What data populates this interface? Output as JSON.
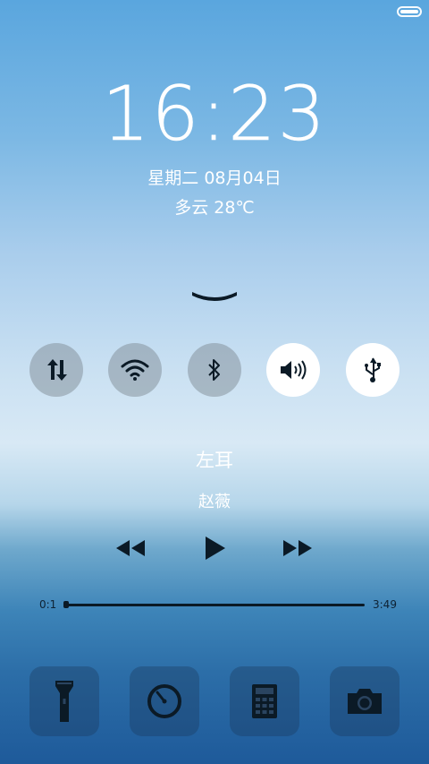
{
  "status_bar": {
    "battery_level": 1.0
  },
  "lockscreen": {
    "time": "16:23",
    "date": "星期二 08月04日",
    "weather": "多云 28℃"
  },
  "quick_toggles": [
    {
      "name": "sync",
      "icon": "sync-icon",
      "state": "off"
    },
    {
      "name": "wifi",
      "icon": "wifi-icon",
      "state": "off"
    },
    {
      "name": "bluetooth",
      "icon": "bluetooth-icon",
      "state": "off"
    },
    {
      "name": "sound",
      "icon": "volume-icon",
      "state": "on"
    },
    {
      "name": "usb",
      "icon": "usb-icon",
      "state": "on"
    }
  ],
  "music": {
    "title": "左耳",
    "artist": "赵薇",
    "elapsed": "0:1",
    "duration": "3:49",
    "progress": 0.004
  },
  "shortcuts": [
    {
      "name": "flashlight",
      "icon": "flashlight-icon"
    },
    {
      "name": "timer",
      "icon": "timer-icon"
    },
    {
      "name": "calculator",
      "icon": "calculator-icon"
    },
    {
      "name": "camera",
      "icon": "camera-icon"
    }
  ],
  "colors": {
    "toggle_off": "#78828c",
    "toggle_on": "#ffffff",
    "icon": "#0b1a26"
  }
}
